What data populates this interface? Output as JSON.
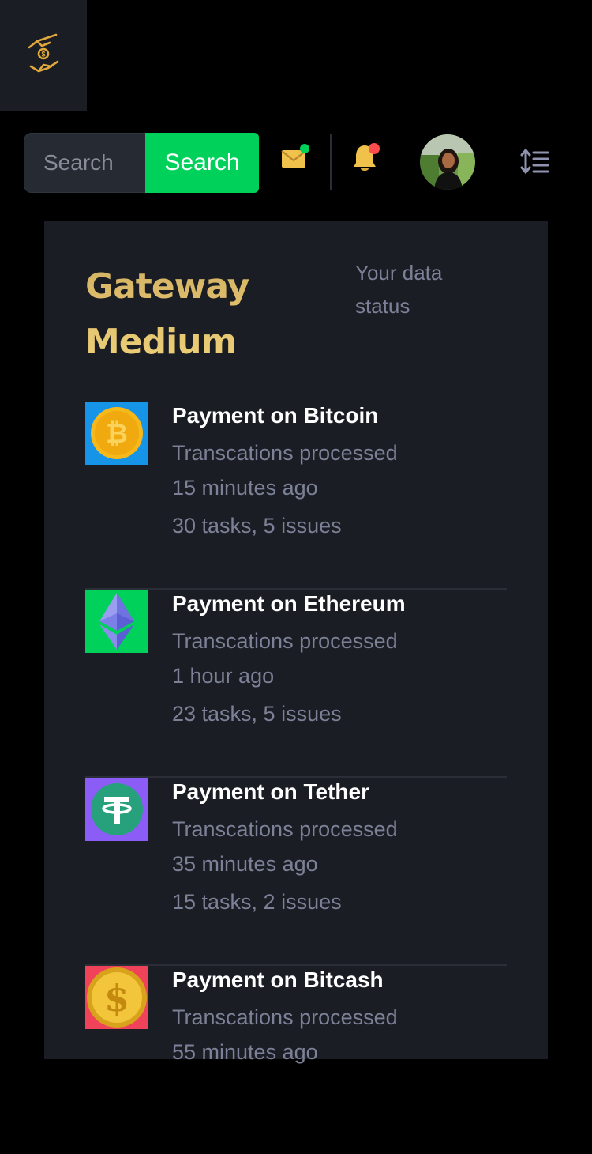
{
  "colors": {
    "background": "#000000",
    "panel": "#1b1d24",
    "accent_green": "#00d15a",
    "gold": "#e2c26f",
    "muted_text": "#7c8197",
    "notification_red": "#ff4d4f"
  },
  "logo": {
    "icon": "hand-coin-icon"
  },
  "search": {
    "placeholder": "Search",
    "button_label": "Search"
  },
  "header_icons": {
    "mail": {
      "icon": "mail-icon",
      "badge_color": "#00d15a"
    },
    "bell": {
      "icon": "bell-icon",
      "badge_color": "#ff4d4f"
    },
    "avatar": "user-avatar",
    "menu": "sort-menu-icon"
  },
  "card": {
    "title": "Gateway Medium",
    "subtitle": "Your data status"
  },
  "transactions": [
    {
      "coin": "bitcoin",
      "icon": "bitcoin-icon",
      "icon_bg": "#1694e8",
      "title": "Payment on Bitcoin",
      "status": "Transcations processed",
      "time": "15 minutes ago",
      "summary": "30 tasks, 5 issues"
    },
    {
      "coin": "ethereum",
      "icon": "ethereum-icon",
      "icon_bg": "#00d15a",
      "title": "Payment on Ethereum",
      "status": "Transcations processed",
      "time": "1 hour ago",
      "summary": "23 tasks, 5 issues"
    },
    {
      "coin": "tether",
      "icon": "tether-icon",
      "icon_bg": "#8b5cf6",
      "title": "Payment on Tether",
      "status": "Transcations processed",
      "time": "35 minutes ago",
      "summary": "15 tasks, 2 issues"
    },
    {
      "coin": "bitcash",
      "icon": "dollar-coin-icon",
      "icon_bg": "#f0435a",
      "title": "Payment on Bitcash",
      "status": "Transcations processed",
      "time": "55 minutes ago",
      "summary": ""
    }
  ]
}
